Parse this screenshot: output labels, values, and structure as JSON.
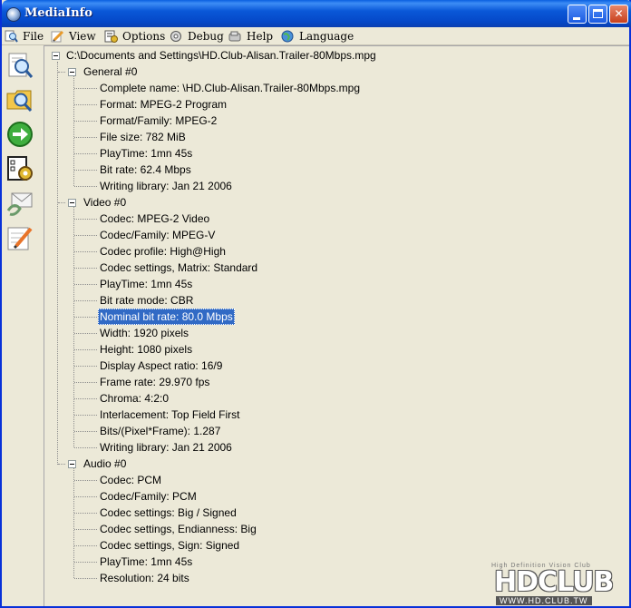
{
  "window": {
    "title": "MediaInfo"
  },
  "menu": [
    {
      "label": "File",
      "icon": "magnifier-icon"
    },
    {
      "label": "View",
      "icon": "pencil-paper-icon"
    },
    {
      "label": "Options",
      "icon": "options-icon"
    },
    {
      "label": "Debug",
      "icon": "debug-icon"
    },
    {
      "label": "Help",
      "icon": "help-icon"
    },
    {
      "label": "Language",
      "icon": "globe-icon"
    }
  ],
  "sidebar": [
    "open-file-icon",
    "open-folder-icon",
    "forward-arrow-icon",
    "settings-icon",
    "send-mail-icon",
    "notes-icon"
  ],
  "tree": {
    "root": "C:\\Documents and Settings\\HD.Club-Alisan.Trailer-80Mbps.mpg",
    "sections": [
      {
        "name": "General #0",
        "items": [
          "Complete name: \\HD.Club-Alisan.Trailer-80Mbps.mpg",
          "Format: MPEG-2 Program",
          "Format/Family: MPEG-2",
          "File size: 782 MiB",
          "PlayTime: 1mn 45s",
          "Bit rate: 62.4 Mbps",
          "Writing library: Jan 21 2006"
        ]
      },
      {
        "name": "Video #0",
        "items": [
          "Codec: MPEG-2 Video",
          "Codec/Family: MPEG-V",
          "Codec profile: High@High",
          "Codec settings, Matrix: Standard",
          "PlayTime: 1mn 45s",
          "Bit rate mode: CBR",
          "Nominal bit rate: 80.0 Mbps",
          "Width: 1920 pixels",
          "Height: 1080 pixels",
          "Display Aspect ratio: 16/9",
          "Frame rate: 29.970 fps",
          "Chroma: 4:2:0",
          "Interlacement: Top Field First",
          "Bits/(Pixel*Frame): 1.287",
          "Writing library: Jan 21 2006"
        ]
      },
      {
        "name": "Audio #0",
        "items": [
          "Codec: PCM",
          "Codec/Family: PCM",
          "Codec settings: Big / Signed",
          "Codec settings, Endianness: Big",
          "Codec settings, Sign: Signed",
          "PlayTime: 1mn 45s",
          "Resolution: 24 bits"
        ]
      }
    ],
    "selected": "Nominal bit rate: 80.0 Mbps"
  },
  "watermark": {
    "tagline": "High Definition Vision Club",
    "logo": "HDCLUB",
    "url": "WWW.HD.CLUB.TW"
  },
  "colors": {
    "titlebar": "#0a58d8",
    "selection": "#316ac5",
    "window_bg": "#ece9d8"
  }
}
